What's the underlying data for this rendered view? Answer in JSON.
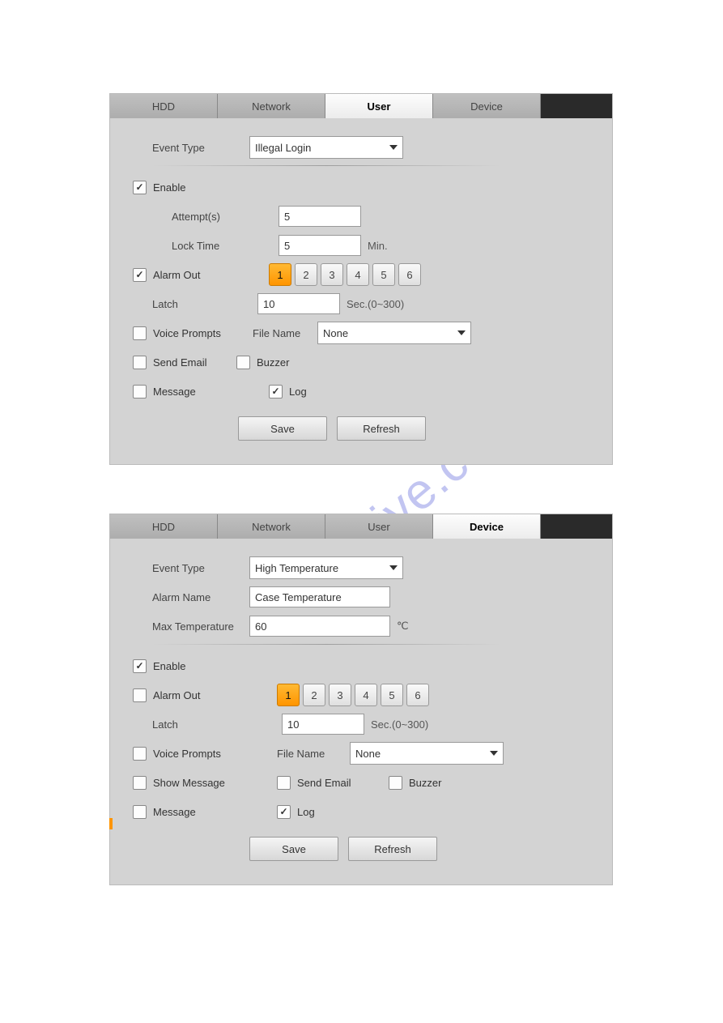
{
  "watermark": "manualshive.com",
  "tabs": {
    "hdd": "HDD",
    "network": "Network",
    "user": "User",
    "device": "Device"
  },
  "panel1": {
    "active_tab": "user",
    "event_type_label": "Event Type",
    "event_type_value": "Illegal Login",
    "enable_label": "Enable",
    "attempts_label": "Attempt(s)",
    "attempts_value": "5",
    "lock_time_label": "Lock Time",
    "lock_time_value": "5",
    "lock_time_unit": "Min.",
    "alarm_out_label": "Alarm Out",
    "alarm_channels": [
      "1",
      "2",
      "3",
      "4",
      "5",
      "6"
    ],
    "alarm_active": "1",
    "latch_label": "Latch",
    "latch_value": "10",
    "latch_unit": "Sec.(0~300)",
    "voice_prompts_label": "Voice Prompts",
    "file_name_label": "File Name",
    "file_name_value": "None",
    "send_email_label": "Send Email",
    "buzzer_label": "Buzzer",
    "message_label": "Message",
    "log_label": "Log",
    "save_label": "Save",
    "refresh_label": "Refresh"
  },
  "panel2": {
    "active_tab": "device",
    "event_type_label": "Event Type",
    "event_type_value": "High Temperature",
    "alarm_name_label": "Alarm Name",
    "alarm_name_value": "Case Temperature",
    "max_temp_label": "Max Temperature",
    "max_temp_value": "60",
    "max_temp_unit": "℃",
    "enable_label": "Enable",
    "alarm_out_label": "Alarm Out",
    "alarm_channels": [
      "1",
      "2",
      "3",
      "4",
      "5",
      "6"
    ],
    "alarm_active": "1",
    "latch_label": "Latch",
    "latch_value": "10",
    "latch_unit": "Sec.(0~300)",
    "voice_prompts_label": "Voice Prompts",
    "file_name_label": "File Name",
    "file_name_value": "None",
    "show_message_label": "Show Message",
    "send_email_label": "Send Email",
    "buzzer_label": "Buzzer",
    "message_label": "Message",
    "log_label": "Log",
    "save_label": "Save",
    "refresh_label": "Refresh"
  }
}
